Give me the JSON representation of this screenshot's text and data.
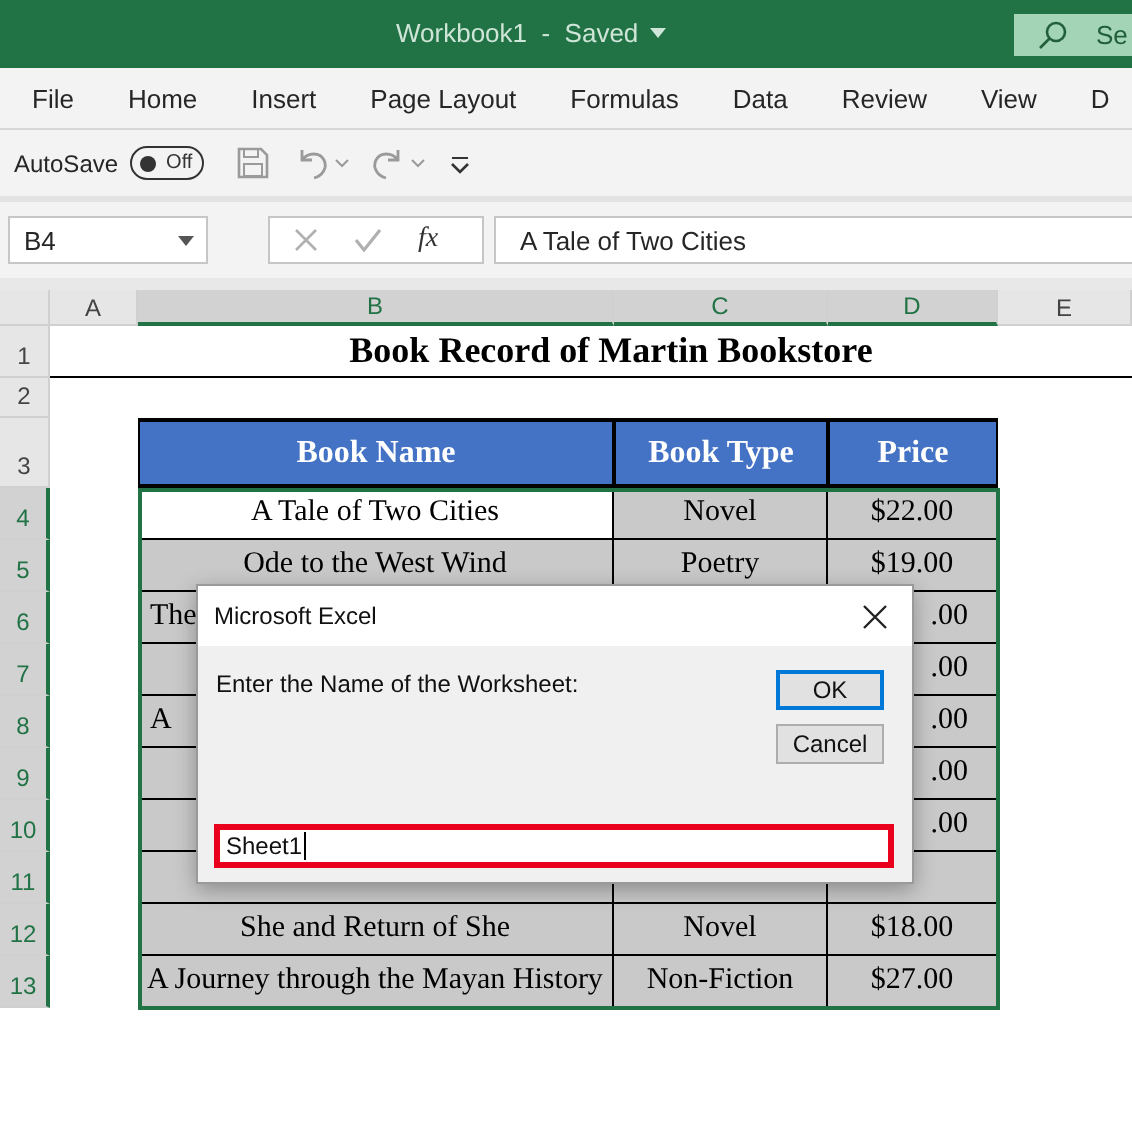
{
  "window": {
    "title": "Workbook1  -  Saved",
    "search_text": "Se"
  },
  "ribbon_tabs": [
    "File",
    "Home",
    "Insert",
    "Page Layout",
    "Formulas",
    "Data",
    "Review",
    "View",
    "D"
  ],
  "quick_access": {
    "autosave_label": "AutoSave",
    "autosave": {
      "label": "Off",
      "on": false
    }
  },
  "formula_bar": {
    "name_box": "B4",
    "function_label": "fx",
    "formula": "A Tale of Two Cities"
  },
  "sheet": {
    "columns": [
      {
        "label": "A",
        "selected": false
      },
      {
        "label": "B",
        "selected": true
      },
      {
        "label": "C",
        "selected": true
      },
      {
        "label": "D",
        "selected": true
      },
      {
        "label": "E",
        "selected": false
      }
    ],
    "rows": [
      {
        "label": "1",
        "selected": false
      },
      {
        "label": "2",
        "selected": false
      },
      {
        "label": "3",
        "selected": false
      },
      {
        "label": "4",
        "selected": true
      },
      {
        "label": "5",
        "selected": true
      },
      {
        "label": "6",
        "selected": true
      },
      {
        "label": "7",
        "selected": true
      },
      {
        "label": "8",
        "selected": true
      },
      {
        "label": "9",
        "selected": true
      },
      {
        "label": "10",
        "selected": true
      },
      {
        "label": "11",
        "selected": true
      },
      {
        "label": "12",
        "selected": true
      },
      {
        "label": "13",
        "selected": true
      }
    ],
    "title": "Book Record of Martin Bookstore",
    "table": {
      "columns": [
        "Book Name",
        "Book Type",
        "Price"
      ],
      "rows": [
        {
          "kind": "full",
          "active": true,
          "cells": [
            "A Tale of Two Cities",
            "Novel",
            "$22.00"
          ]
        },
        {
          "kind": "full",
          "active": false,
          "cells": [
            "Ode to the West Wind",
            "Poetry",
            "$19.00"
          ]
        },
        {
          "kind": "partial",
          "name_fragment": "The",
          "price_fragment": ".00"
        },
        {
          "kind": "partial",
          "price_fragment": ".00"
        },
        {
          "kind": "partial",
          "name_fragment": "A",
          "price_fragment": ".00"
        },
        {
          "kind": "partial",
          "price_fragment": ".00"
        },
        {
          "kind": "partial",
          "price_fragment": ".00"
        },
        {
          "kind": "partial"
        },
        {
          "kind": "full",
          "active": false,
          "cells": [
            "She and Return of She",
            "Novel",
            "$18.00"
          ]
        },
        {
          "kind": "full",
          "active": false,
          "cells": [
            "A Journey through the Mayan History",
            "Non-Fiction",
            "$27.00"
          ]
        }
      ]
    }
  },
  "dialog": {
    "title": "Microsoft Excel",
    "prompt": "Enter the Name of the Worksheet:",
    "buttons": [
      {
        "label": "OK",
        "default": true
      },
      {
        "label": "Cancel",
        "default": false
      }
    ],
    "input_value": "Sheet1"
  }
}
